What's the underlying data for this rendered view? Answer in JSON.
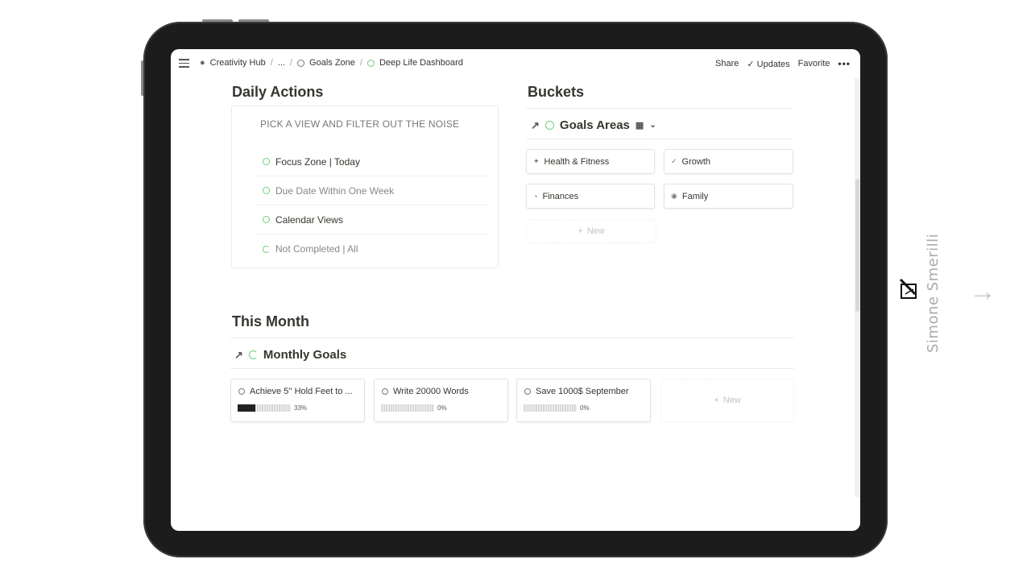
{
  "topbar": {
    "breadcrumbs": [
      "Creativity Hub",
      "...",
      "Goals Zone",
      "Deep Life Dashboard"
    ],
    "share": "Share",
    "updates": "Updates",
    "favorite": "Favorite",
    "more": "•••"
  },
  "daily": {
    "heading": "Daily Actions",
    "subtitle": "PICK A VIEW AND FILTER OUT THE NOISE",
    "items": [
      "Focus Zone | Today",
      "Due Date Within One Week",
      "Calendar Views",
      "Not Completed | All"
    ]
  },
  "buckets": {
    "heading": "Buckets",
    "db_title": "Goals Areas",
    "cards": [
      "Health & Fitness",
      "Growth",
      "Finances",
      "Family"
    ],
    "new_label": "New"
  },
  "month": {
    "heading": "This Month",
    "db_title": "Monthly Goals",
    "goals": [
      {
        "title": "Achieve 5'' Hold Feet to ...",
        "progress": 0.33,
        "progress_label": "33%"
      },
      {
        "title": "Write 20000 Words",
        "progress": 0,
        "progress_label": "0%"
      },
      {
        "title": "Save 1000$ September",
        "progress": 0,
        "progress_label": "0%"
      }
    ],
    "new_label": "New"
  },
  "side": {
    "author": "Simone Smerilli",
    "next_arrow": "→"
  },
  "colors": {
    "accent_green": "#6fce7f",
    "text": "#37352f"
  }
}
